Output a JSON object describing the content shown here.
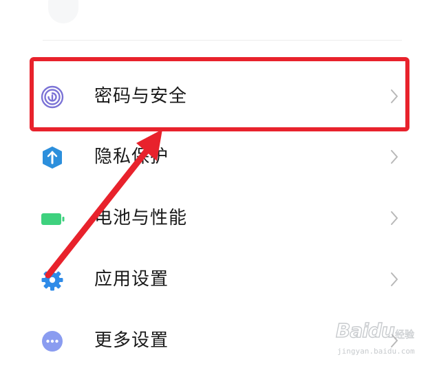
{
  "settings": {
    "items": [
      {
        "label": "密码与安全",
        "icon": "fingerprint-icon",
        "icon_color": "#7b73d6"
      },
      {
        "label": "隐私保护",
        "icon": "shield-icon",
        "icon_color": "#2c8fdc"
      },
      {
        "label": "电池与性能",
        "icon": "battery-icon",
        "icon_color": "#3ed17e"
      },
      {
        "label": "应用设置",
        "icon": "gear-icon",
        "icon_color": "#2f8be8"
      },
      {
        "label": "更多设置",
        "icon": "more-dots-icon",
        "icon_color": "#8a9cf0"
      }
    ],
    "chevron_icon": "chevron-right-icon",
    "chevron_color": "#b8b8b8"
  },
  "annotation": {
    "highlight_color": "#e8222c",
    "highlighted_item": "密码与安全",
    "arrow_icon": "red-arrow-icon"
  },
  "watermark": {
    "brand": "Baidu",
    "sub": "经验",
    "domain": "jingyan.baidu.com"
  }
}
